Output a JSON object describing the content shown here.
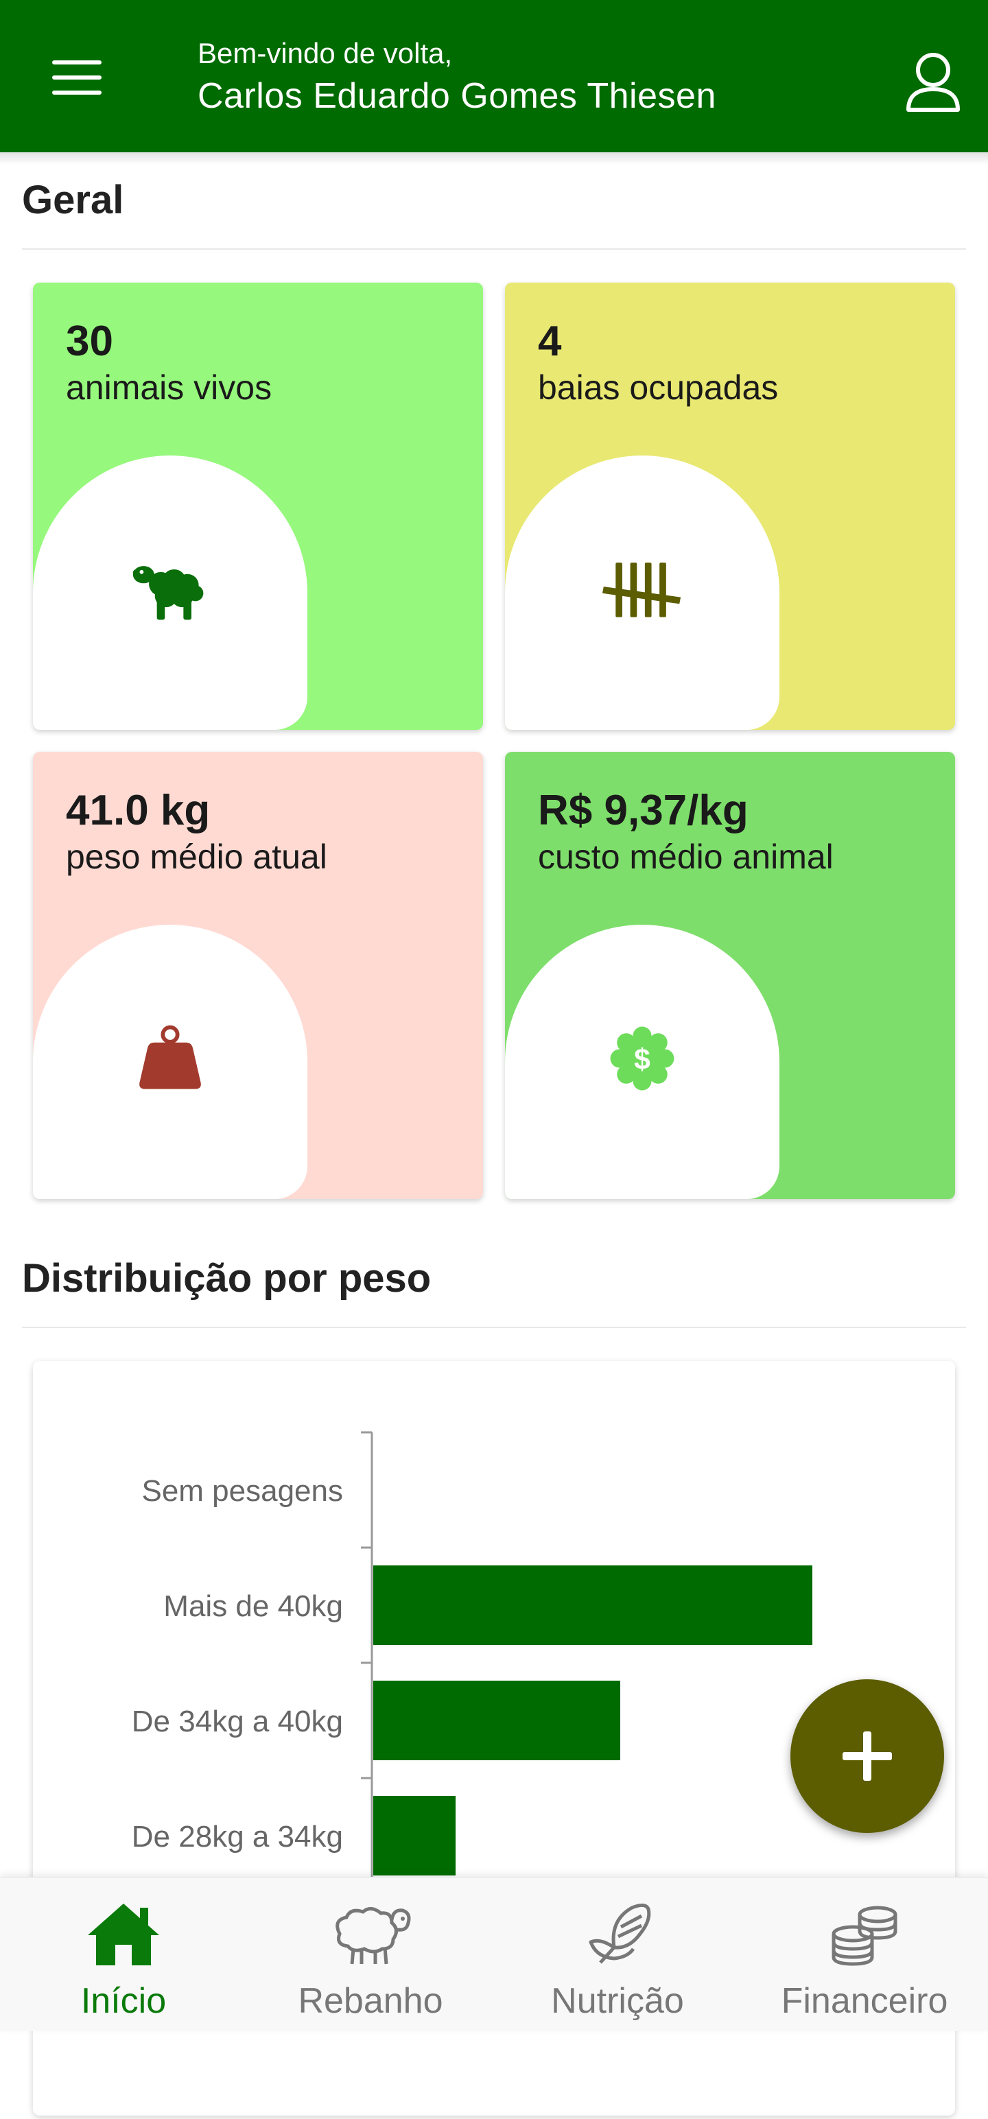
{
  "header": {
    "greeting": "Bem-vindo de volta,",
    "user_name": "Carlos Eduardo Gomes Thiesen",
    "menu_icon": "hamburger-menu-icon",
    "profile_icon": "user-profile-icon"
  },
  "sections": {
    "overview_title": "Geral",
    "distribution_title": "Distribuição por peso"
  },
  "cards": [
    {
      "value": "30",
      "label": "animais vivos",
      "icon": "sheep-icon",
      "color": "#96f87c",
      "icon_color": "#0a6e0a"
    },
    {
      "value": "4",
      "label": "baias ocupadas",
      "icon": "tally-marks-icon",
      "color": "#e8e872",
      "icon_color": "#5c5c00"
    },
    {
      "value": "41.0 kg",
      "label": "peso médio atual",
      "icon": "weight-icon",
      "color": "#ffdad3",
      "icon_color": "#a23b2e"
    },
    {
      "value": "R$ 9,37/kg",
      "label": "custo médio animal",
      "icon": "dollar-badge-icon",
      "color": "#7ede6b",
      "icon_color": "#6ddc5a"
    }
  ],
  "chart_data": {
    "type": "bar",
    "orientation": "horizontal",
    "categories": [
      "Sem pesagens",
      "Mais de 40kg",
      "De 34kg a 40kg",
      "De 28kg a 34kg"
    ],
    "values": [
      0,
      16,
      9,
      3
    ],
    "xlim": [
      0,
      20
    ],
    "bar_color": "#006b00",
    "grid": false
  },
  "fab": {
    "icon": "plus-icon",
    "color": "#5c5c00"
  },
  "bottom_nav": [
    {
      "label": "Início",
      "icon": "home-icon",
      "active": true
    },
    {
      "label": "Rebanho",
      "icon": "sheep-outline-icon",
      "active": false
    },
    {
      "label": "Nutrição",
      "icon": "corn-icon",
      "active": false
    },
    {
      "label": "Financeiro",
      "icon": "coins-icon",
      "active": false
    }
  ]
}
